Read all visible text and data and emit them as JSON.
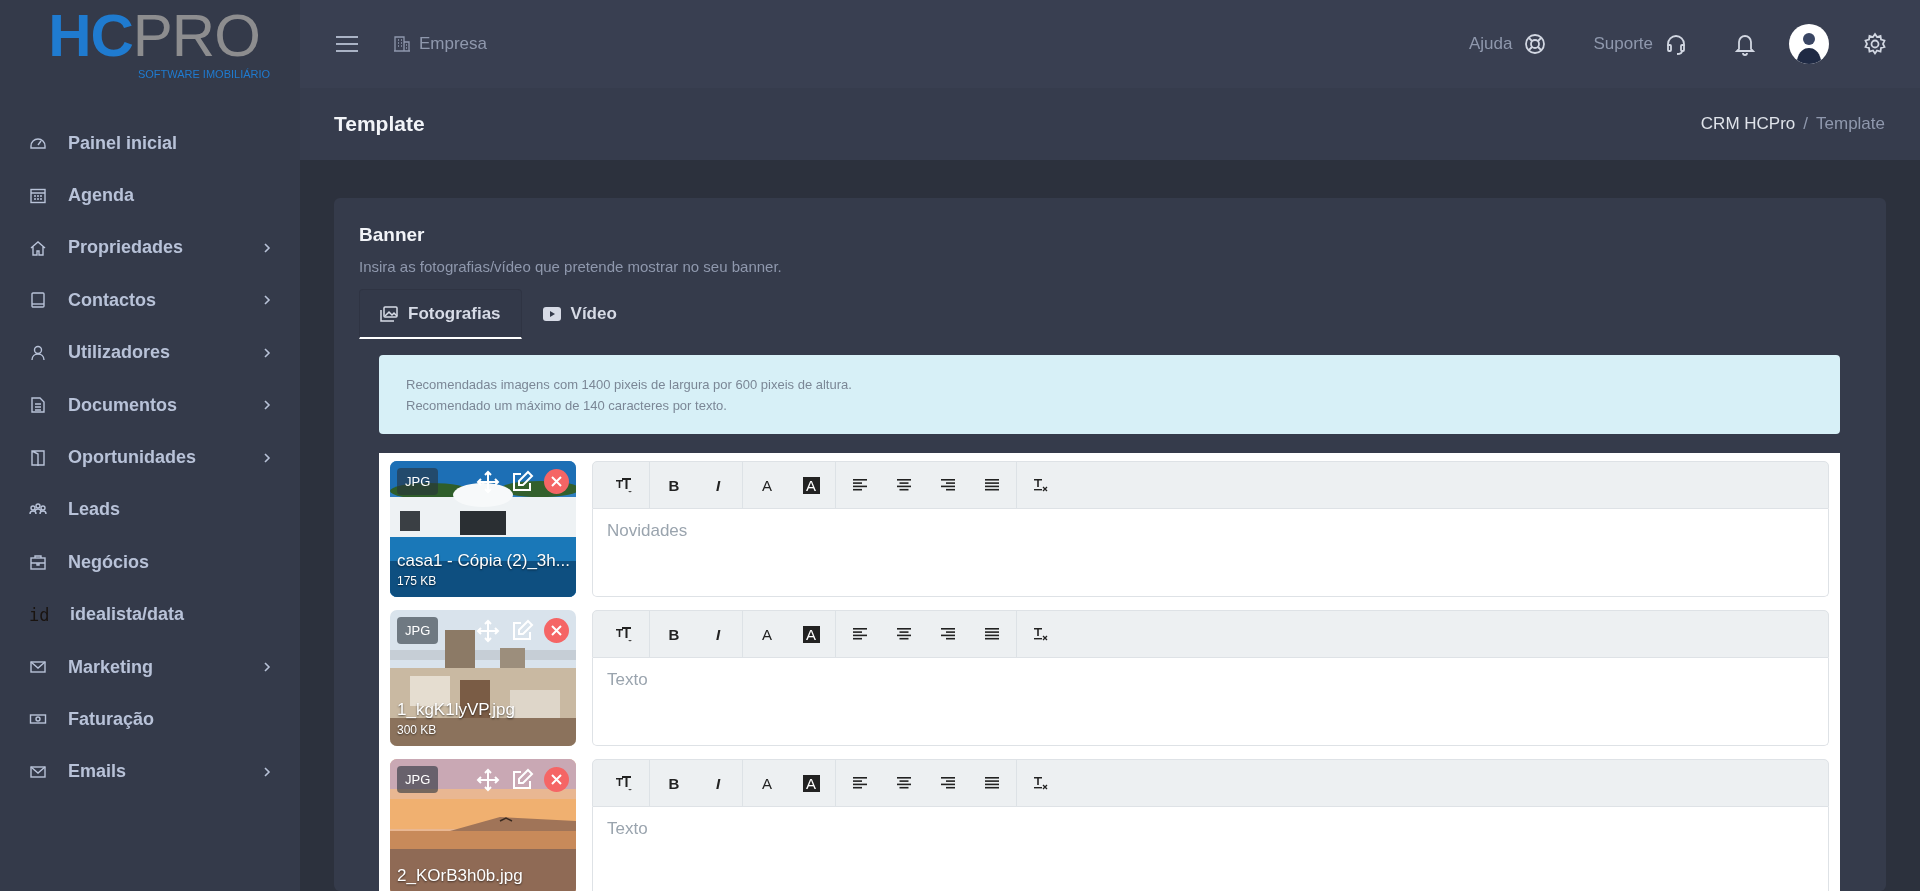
{
  "logo": {
    "first": "HC",
    "second": "PRO",
    "tagline": "SOFTWARE IMOBILIÁRIO"
  },
  "sidebar": {
    "items": [
      {
        "label": "Painel inicial",
        "has_submenu": false
      },
      {
        "label": "Agenda",
        "has_submenu": false
      },
      {
        "label": "Propriedades",
        "has_submenu": true
      },
      {
        "label": "Contactos",
        "has_submenu": true
      },
      {
        "label": "Utilizadores",
        "has_submenu": true
      },
      {
        "label": "Documentos",
        "has_submenu": true
      },
      {
        "label": "Oportunidades",
        "has_submenu": true
      },
      {
        "label": "Leads",
        "has_submenu": false
      },
      {
        "label": "Negócios",
        "has_submenu": false
      },
      {
        "label": "idealista/data",
        "icon_text": "id",
        "has_submenu": false
      },
      {
        "label": "Marketing",
        "has_submenu": true
      },
      {
        "label": "Faturação",
        "has_submenu": false
      },
      {
        "label": "Emails",
        "has_submenu": true
      }
    ]
  },
  "topbar": {
    "company": "Empresa",
    "help": "Ajuda",
    "support": "Suporte"
  },
  "page_header": {
    "title": "Template",
    "breadcrumbs": [
      "CRM HCPro",
      "Template"
    ],
    "separator": "/"
  },
  "banner": {
    "title": "Banner",
    "subtitle": "Insira as fotografias/vídeo que pretende mostrar no seu banner.",
    "tabs": [
      {
        "label": "Fotografias",
        "selected": true
      },
      {
        "label": "Vídeo",
        "selected": false
      }
    ],
    "notice": [
      "Recomendadas imagens com 1400 pixeis de largura por 600 pixeis de altura.",
      "Recomendado um máximo de 140 caracteres por texto."
    ],
    "slides": [
      {
        "type": "JPG",
        "file_name": "casa1 - Cópia (2)_3h...",
        "file_size": "175 KB",
        "placeholder": "Novidades",
        "toolbar": [
          {
            "kind": "size"
          },
          {
            "kind": "bold",
            "label": "B"
          },
          {
            "kind": "italic",
            "label": "I"
          },
          {
            "kind": "color",
            "label": "A"
          },
          {
            "kind": "highlight",
            "label": "A"
          },
          {
            "kind": "align_left"
          },
          {
            "kind": "align_center"
          },
          {
            "kind": "align_right"
          },
          {
            "kind": "justify"
          },
          {
            "kind": "clear"
          }
        ]
      },
      {
        "type": "JPG",
        "file_name": "1_kgK1lyVP.jpg",
        "file_size": "300 KB",
        "placeholder": "Texto",
        "toolbar": [
          {
            "kind": "size"
          },
          {
            "kind": "bold",
            "label": "B"
          },
          {
            "kind": "italic",
            "label": "I"
          },
          {
            "kind": "color",
            "label": "A"
          },
          {
            "kind": "highlight",
            "label": "A"
          },
          {
            "kind": "align_left"
          },
          {
            "kind": "align_center"
          },
          {
            "kind": "align_right"
          },
          {
            "kind": "justify"
          },
          {
            "kind": "clear"
          }
        ]
      },
      {
        "type": "JPG",
        "file_name": "2_KOrB3h0b.jpg",
        "placeholder": "Texto",
        "toolbar": [
          {
            "kind": "size"
          },
          {
            "kind": "bold",
            "label": "B"
          },
          {
            "kind": "italic",
            "label": "I"
          },
          {
            "kind": "color",
            "label": "A"
          },
          {
            "kind": "highlight",
            "label": "A"
          },
          {
            "kind": "align_left"
          },
          {
            "kind": "align_center"
          },
          {
            "kind": "align_right"
          },
          {
            "kind": "justify"
          },
          {
            "kind": "clear"
          }
        ]
      }
    ]
  }
}
